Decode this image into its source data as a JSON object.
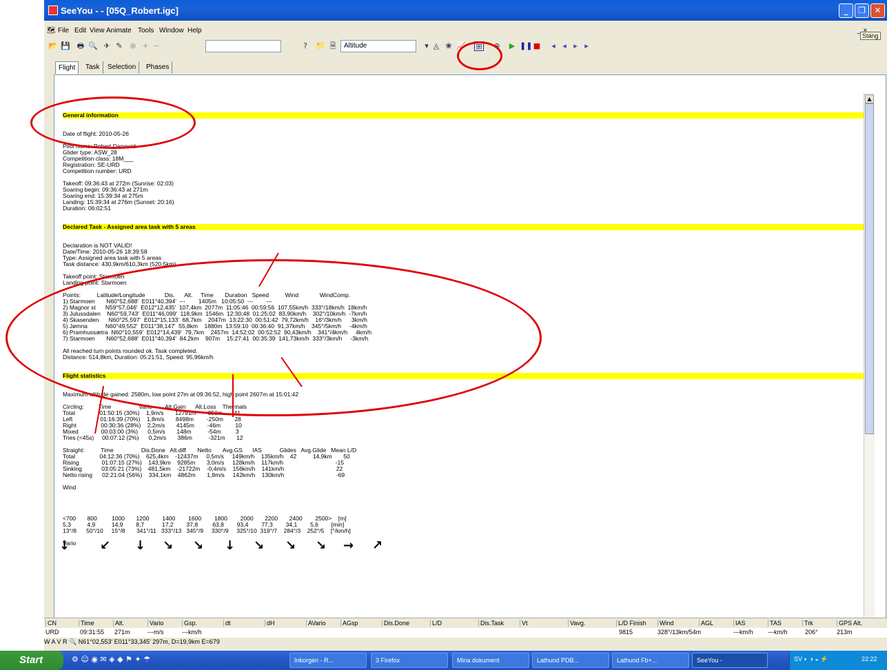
{
  "window": {
    "title": "SeeYou -  - [05Q_Robert.igc]",
    "close_tooltip": "Stäng"
  },
  "menu": [
    "File",
    "Edit",
    "View",
    "Animate",
    "Tools",
    "Window",
    "Help"
  ],
  "toolbar": {
    "altitude_combo": "Altitude"
  },
  "tabs": [
    "Flight",
    "Task",
    "Selection",
    "Phases"
  ],
  "report": {
    "general_header": "General information",
    "general": "Date of flight: 2010-05-26\n\nPilot name: Robert.Danewid\nGlider type: ASW_28\nCompetition class: 18M___\nRegistration: SE-URD\nCompetition number: URD\n\nTakeoff: 09:36:43 at 272m (Sunrise: 02:03)\nSoaring begin: 09:36:43 at 271m\nSoaring end: 15:39:34 at 275m\nLanding: 15:39:34 at 276m (Sunset: 20:16)\nDuration: 06:02:51\n",
    "task_header": "Declared Task - Assigned area task with 5 areas",
    "task": "Declaration is NOT VALID!\nDate/Time: 2010-05-26 18:39:58\nType: Assigned area task with 5 areas\nTask distance: 430,9km/610,3km (520,5km)\n\nTakeoff point: Starmoen\nLanding point: Starmoen\n\nPoints:          Latitude/Longitude            Dis.      Alt.     Time       Duration   Speed          Wind             WindComp.\n1) Starmoen       N60°52,688'  E011°40,394'  ---        1405m   10:05:50  ---        ---\n2) Magnor st      N59°57,046'  E012°12,435'  107,4km  2077m  11:05:46  00:59:56  107,55km/h  333°/18km/h  18km/h\n3) Julussdalen    N60°59,743'  E011°46,099'  118,9km  1546m  12:30:48  01:25:02  83,90km/h    302°/10km/h  -7km/h\n4) Skasenden      N60°25,597'  E012°15,133'  68,7km    2047m  13:22:30  00:51:42  79,72km/h    16°/3km/h      3km/h\n5) Jømna           N60°49,552'  E011°38,147'  55,8km    1880m  13:59:10  00:36:40  91,37km/h    345°/5km/h     -4km/h\n6) Pramhussætra  N60°10,559'  E012°14,439'  79,7km    2457m  14:52:02  00:52:52  90,43km/h    341°/4km/h     4km/h\n7) Starmoen       N60°52,688'  E011°40,394'  84,2km    907m    15:27:41  00:35:39  141,73km/h  333°/3km/h     -3km/h\n\nAll reached turn points rounded ok. Task completed.\nDistance: 514,8km, Duration: 05:21:51, Speed: 95,96km/h\n",
    "stats_header": "Flight statistics",
    "stats": "Maximum altitude gained: 2580m, low point 27m at 09:36:52, high point 2607m at 15:01:42\n\nCircling:         Time                 Vario        Alt.Gain      Alt.Loss    Thermals\nTotal               01:50:15 (30%)    1,9m/s       12791m      -350m       41\nLeft                 01:16:39 (70%)    1,8m/s       8498m        -250m       28\nRight               00:30:36 (28%)    2,2m/s       4145m        -46m         10\nMixed              00:03:00 (3%)      0,5m/s       148m          -54m         3\nTries (<45s)     00:07:12 (2%)      0,2m/s       386m          -321m       12\n\nStraight:          Time                 Dis.Done   Alt.diff       Netto       Avg.GS      IAS           Glides   Avg.Glide   Mean L/D\nTotal               04:12:36 (70%)    625,4km    -12437m     0,5m/s     149km/h    135km/h    42          14,9km       50\nRising              01:07:15 (27%)    143,9km    9285m       3,0m/s     128km/h    117km/h                                -15\nSinking            03:05:21 (73%)    481,5km    -21722m    -0,4m/s    156km/h    141km/h                                22\nNetto rising      02:21:04 (56%)    334,1km    4862m       1,8m/s     142km/h    130km/h                                -69\n\nWind\n\n\n\n\n<700       800         1000       1200        1400        1600        1800        2000       2200       2400        2500>    [m]\n5,3          4,9          14,9        8,7           17,2        37,8         63,8        93,4        77,3        34,1        5,6        [min]\n13°/8      50°/10     15°/8       341°/11   333°/13   345°/9     330°/9     325°/10  319°/7    284°/3    252°/5    [°/km/h]\n\nVario"
  },
  "wind_arrows": [
    "↓",
    "↙",
    "↓",
    "↘",
    "↘",
    "↓",
    "↘",
    "↘",
    "↘",
    "→",
    "↗"
  ],
  "columns": [
    "CN",
    "Time",
    "Alt.",
    "Vario",
    "Gsp.",
    "dt",
    "dH",
    "AVario",
    "AGsp",
    "Dis.Done",
    "L/D",
    "Dis.Task",
    "Vt",
    "Vavg.",
    "L/D Finish",
    "Wind",
    "AGL",
    "IAS",
    "TAS",
    "Trk",
    "GPS Alt."
  ],
  "row": {
    "cn": "URD",
    "time": "09:31:55",
    "alt": "271m",
    "vario": "---m/s",
    "gsp": "---km/h",
    "ld_finish": "9815",
    "wind": "328°/13km/54m",
    "ias": "---km/h",
    "tas": "---km/h",
    "trk": "206°",
    "gps": "213m"
  },
  "status": "W  A  V  R  🔍 N61°02,553' E011°33,345' 297m, D=19,9km E=679",
  "taskbar": {
    "start": "Start",
    "items": [
      "Inkorgen - R...",
      "3 Firefox",
      "Mina dokument",
      "Lathund PDB...",
      "Lathund Fb+...",
      "SeeYou -"
    ],
    "clock": "22:22"
  }
}
